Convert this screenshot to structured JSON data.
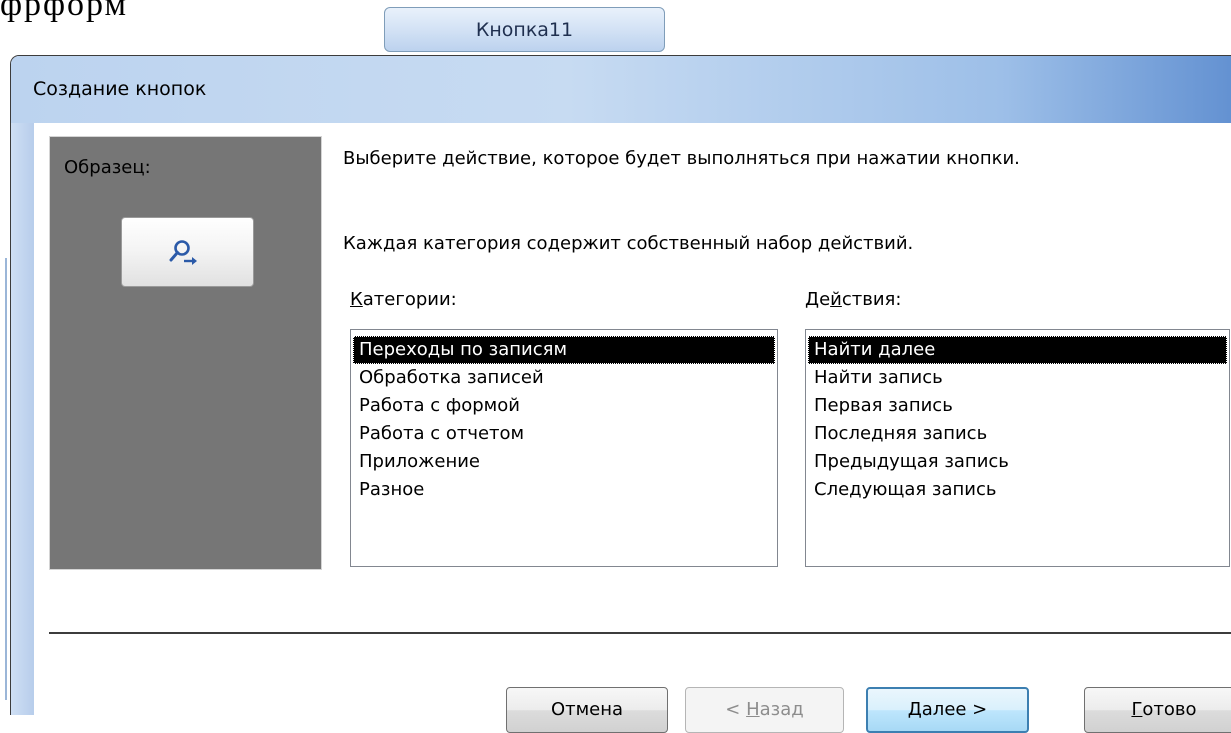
{
  "document_text": "фрформ",
  "top_button": {
    "label": "Кнопка11"
  },
  "dialog": {
    "title": "Создание кнопок",
    "sample": {
      "label": "Образец:",
      "button_icon": "find-next-icon"
    },
    "instruction_1": "Выберите действие, которое будет выполняться при нажатии кнопки.",
    "instruction_2": "Каждая категория содержит собственный набор действий.",
    "categories": {
      "label_accel": "К",
      "label_rest": "атегории:",
      "items": [
        "Переходы по записям",
        "Обработка записей",
        "Работа с формой",
        "Работа с отчетом",
        "Приложение",
        "Разное"
      ],
      "selected": "Переходы по записям"
    },
    "actions": {
      "label_pre": "Де",
      "label_accel": "й",
      "label_rest": "ствия:",
      "items": [
        "Найти далее",
        "Найти запись",
        "Первая запись",
        "Последняя запись",
        "Предыдущая запись",
        "Следующая запись"
      ],
      "selected": "Найти далее"
    },
    "buttons": {
      "cancel": "Отмена",
      "back_pre": "< ",
      "back_accel": "Н",
      "back_rest": "азад",
      "next_accel": "Д",
      "next_rest": "алее >",
      "finish_accel": "Г",
      "finish_rest": "отово"
    }
  }
}
